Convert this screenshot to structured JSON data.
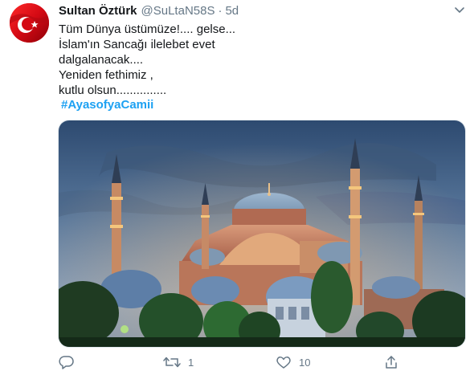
{
  "tweet": {
    "display_name": "Sultan Öztürk",
    "handle": "@SuLtaN58S",
    "separator": "·",
    "time": "5d",
    "lines": [
      "Tüm Dünya üstümüze!.... gelse...",
      "İslam'ın Sancağı ilelebet evet",
      "dalgalanacak....",
      "Yeniden fethimiz ,",
      "kutlu olsun..............."
    ],
    "hashtag": "#AyasofyaCamii"
  },
  "actions": {
    "reply_count": "",
    "retweet_count": "1",
    "like_count": "10"
  },
  "icons": {
    "caret": "chevron-down-icon",
    "reply": "reply-icon",
    "retweet": "retweet-icon",
    "like": "heart-icon",
    "share": "share-icon"
  },
  "colors": {
    "accent": "#1da1f2",
    "secondary_text": "#657786",
    "primary_text": "#14171a",
    "flag_red": "#e30a17"
  }
}
